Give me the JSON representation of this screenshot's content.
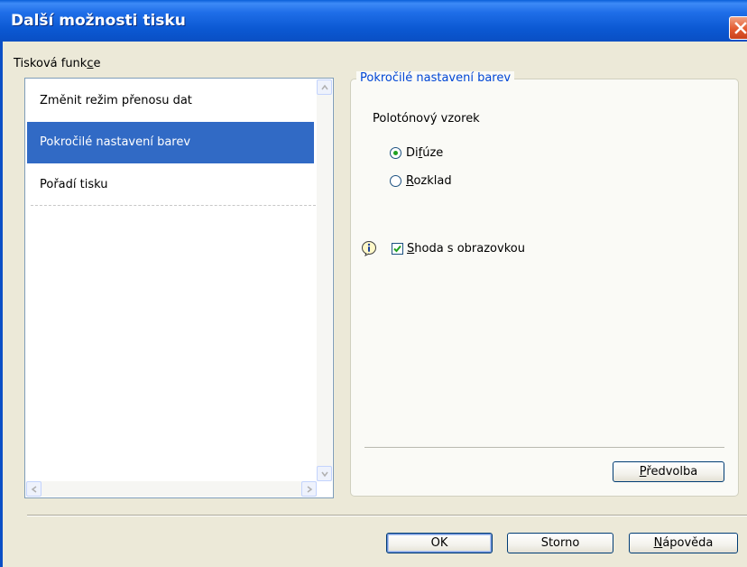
{
  "window": {
    "title": "Další možnosti tisku"
  },
  "functions": {
    "label_pre": "Tisková funk",
    "label_accel": "c",
    "label_post": "e",
    "items": [
      {
        "label": "Změnit režim přenosu dat",
        "selected": false
      },
      {
        "label": "Pokročilé nastavení barev",
        "selected": true
      },
      {
        "label": "Pořadí tisku",
        "selected": false
      }
    ]
  },
  "group": {
    "title": "Pokročilé nastavení barev",
    "halftone_label": "Polotónový vzorek",
    "radios": [
      {
        "pre": "Di",
        "accel": "f",
        "post": "úze",
        "checked": true
      },
      {
        "pre": "",
        "accel": "R",
        "post": "ozklad",
        "checked": false
      }
    ],
    "screen_match": {
      "pre": "",
      "accel": "S",
      "post": "hoda s obrazovkou",
      "checked": true
    },
    "default_button": {
      "pre": "",
      "accel": "P",
      "post": "ředvolba"
    }
  },
  "buttons": {
    "ok": "OK",
    "cancel": "Storno",
    "help_pre": "",
    "help_accel": "N",
    "help_post": "ápověda"
  },
  "colors": {
    "selection": "#316ac5",
    "group_title": "#0046d5",
    "titlebar": "#0a5fd8"
  }
}
